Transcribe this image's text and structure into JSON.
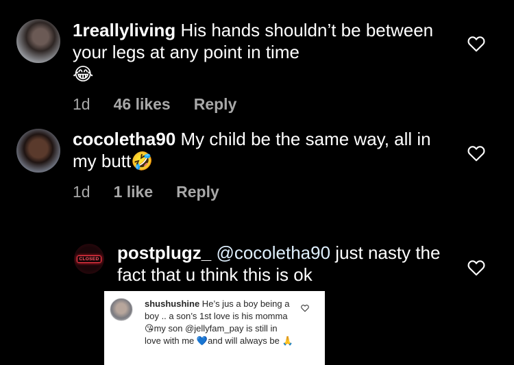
{
  "comments": [
    {
      "username": "1reallyliving",
      "text": " His hands shouldn’t be between your legs at any point in time",
      "emoji": "😂",
      "time": "1d",
      "likes": "46 likes",
      "reply": "Reply"
    },
    {
      "username": "cocoletha90",
      "text": " My child be the same way, all in my butt",
      "emoji": "🤣",
      "time": "1d",
      "likes": "1 like",
      "reply": "Reply"
    },
    {
      "username": "postplugz_",
      "mention": " @cocoletha90",
      "text": " just nasty the fact that u think this is ok",
      "avatar_sign": "CLOSED"
    }
  ],
  "embed": {
    "username": "shushushine",
    "text1": " He’s jus a boy being a boy .. a son’s 1st love is his momma ",
    "emoji1": "😘",
    "text2": "my son ",
    "mention": "@jellyfam_pay",
    "text3": " is still in love with me ",
    "emoji2": "💙",
    "text4": "and will always be ",
    "emoji3": "🙏"
  },
  "icons": {
    "like": "heart-outline-icon"
  }
}
